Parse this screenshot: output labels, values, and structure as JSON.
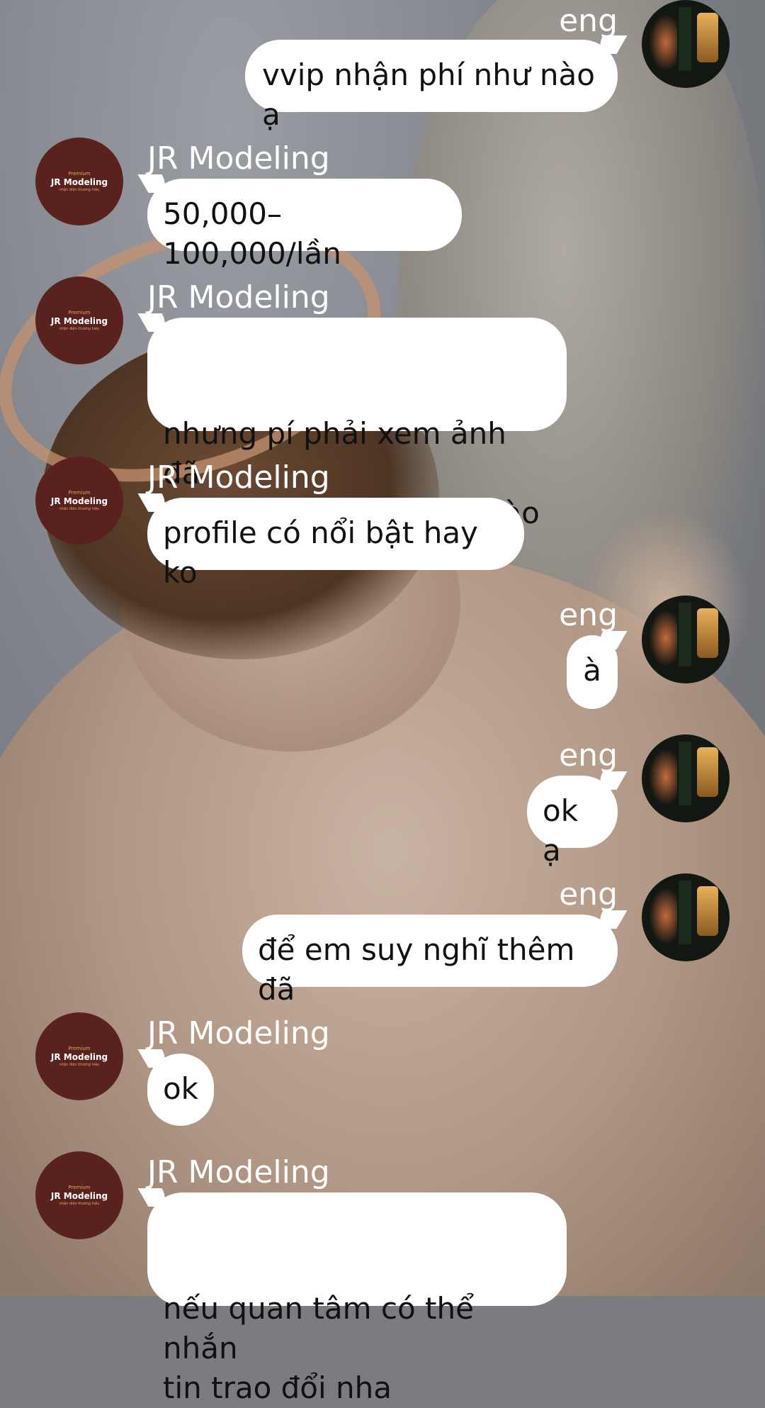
{
  "contacts": {
    "me": {
      "name": "eng"
    },
    "other": {
      "name": "JR Modeling",
      "avatar_premium": "Premium",
      "avatar_title": "JR Modeling",
      "avatar_sub": "nhận diện thương hiệu"
    }
  },
  "messages": [
    {
      "sender": "eng",
      "text": "vvip nhận phí như nào ạ"
    },
    {
      "sender": "JR Modeling",
      "text": "50,000–100,000/lần"
    },
    {
      "sender": "JR Modeling",
      "text": "nhưng pí phải xem ảnh đã\nnhá để xem rate như nào"
    },
    {
      "sender": "JR Modeling",
      "text": "profile có nổi bật hay ko"
    },
    {
      "sender": "eng",
      "text": "à"
    },
    {
      "sender": "eng",
      "text": "ok ạ"
    },
    {
      "sender": "eng",
      "text": "để em suy nghĩ thêm đã"
    },
    {
      "sender": "JR Modeling",
      "text": "ok"
    },
    {
      "sender": "JR Modeling",
      "text": "nếu quan tâm có thể nhắn\ntin trao đổi nha"
    }
  ],
  "colors": {
    "bubble": "#ffffff",
    "text": "#111111",
    "name": "#ffffff",
    "brand_avatar": "#5a221e"
  }
}
